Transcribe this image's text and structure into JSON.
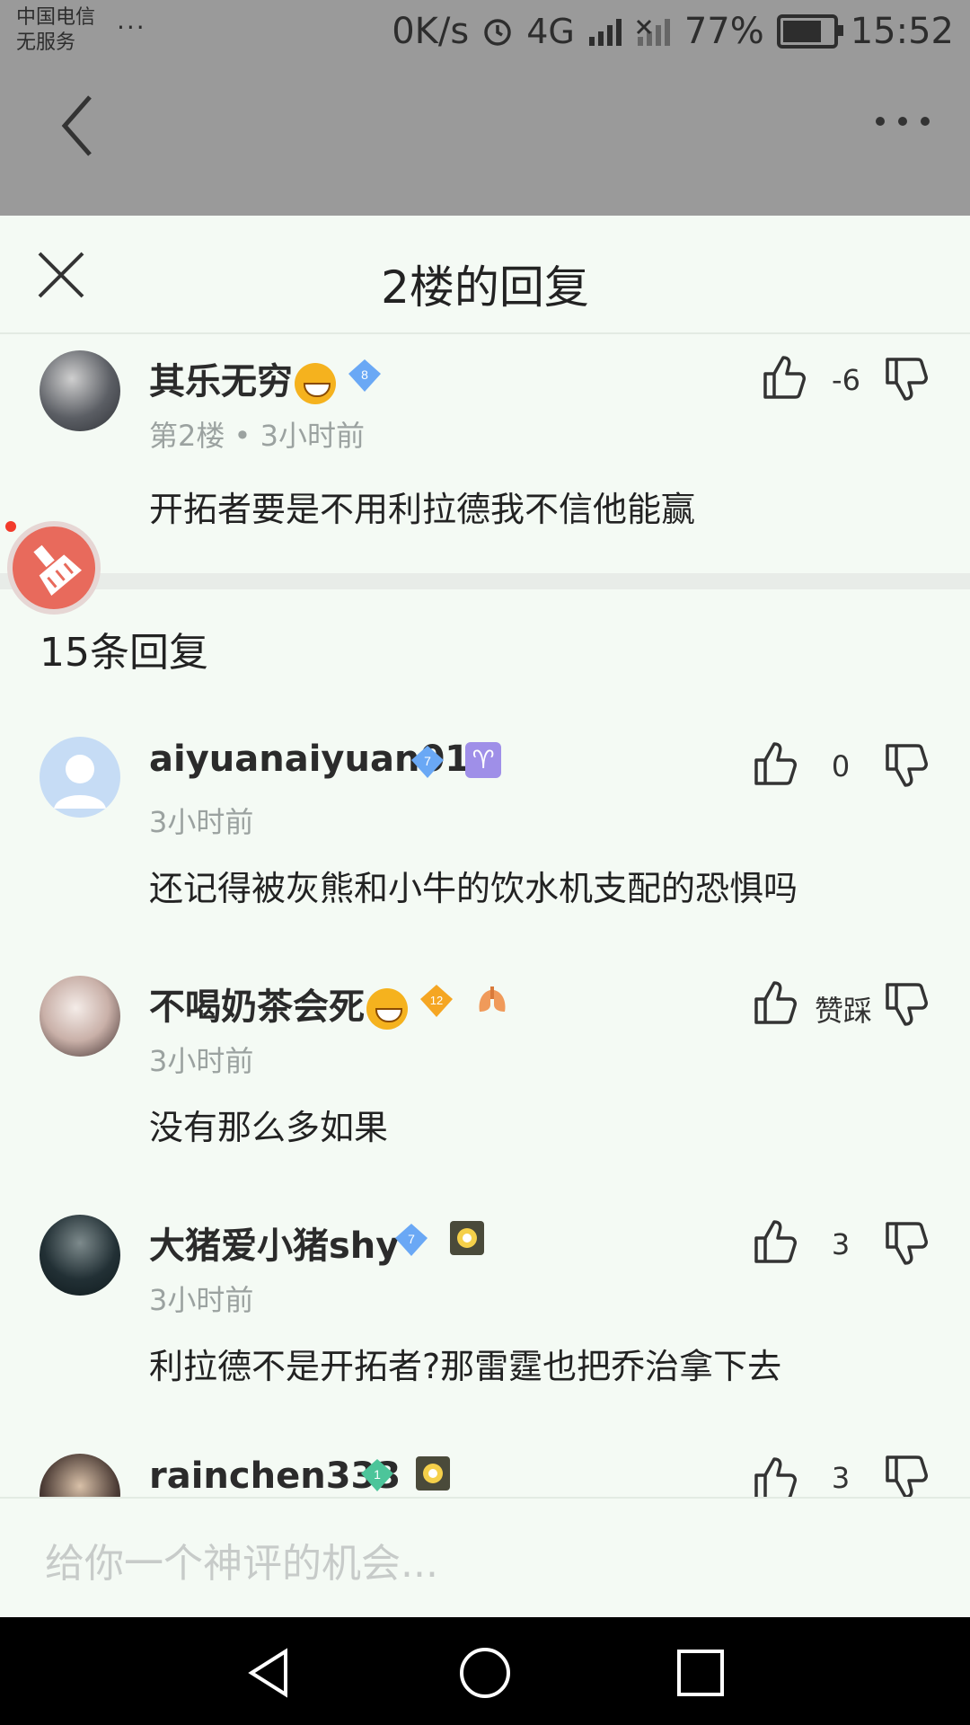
{
  "status_bar": {
    "carrier_line1": "中国电信",
    "carrier_line2": "无服务",
    "more_dots": "···",
    "speed": "0K/s",
    "network": "4G",
    "battery": "77%",
    "time": "15:52"
  },
  "sheet": {
    "title": "2楼的回复"
  },
  "main_comment": {
    "username": "其乐无穷",
    "level_badge": "8",
    "floor": "第2楼",
    "time": "3小时前",
    "text": "开拓者要是不用利拉德我不信他能赢",
    "vote_count": "-6"
  },
  "replies_count": "15条回复",
  "replies": [
    {
      "username": "aiyuanaiyuan01",
      "level_badge": "7",
      "extra_badge": "♈",
      "time": "3小时前",
      "text": "还记得被灰熊和小牛的饮水机支配的恐惧吗",
      "vote_count": "0"
    },
    {
      "username": "不喝奶茶会死",
      "level_badge": "12",
      "time": "3小时前",
      "text": "没有那么多如果",
      "vote_count": "赞踩"
    },
    {
      "username": "大猪爱小猪shy",
      "level_badge": "7",
      "time": "3小时前",
      "text": "利拉德不是开拓者?那雷霆也把乔治拿下去",
      "vote_count": "3"
    },
    {
      "username": "rainchen333",
      "level_badge": "1",
      "vote_count": "3"
    }
  ],
  "input": {
    "placeholder": "给你一个神评的机会..."
  },
  "colors": {
    "background": "#f4faf4",
    "dim": "#9a9a9a",
    "badge_blue": "#6aa8f5",
    "badge_orange": "#f5a623",
    "badge_green": "#4cc59a",
    "floating_button": "#e86a5c"
  }
}
